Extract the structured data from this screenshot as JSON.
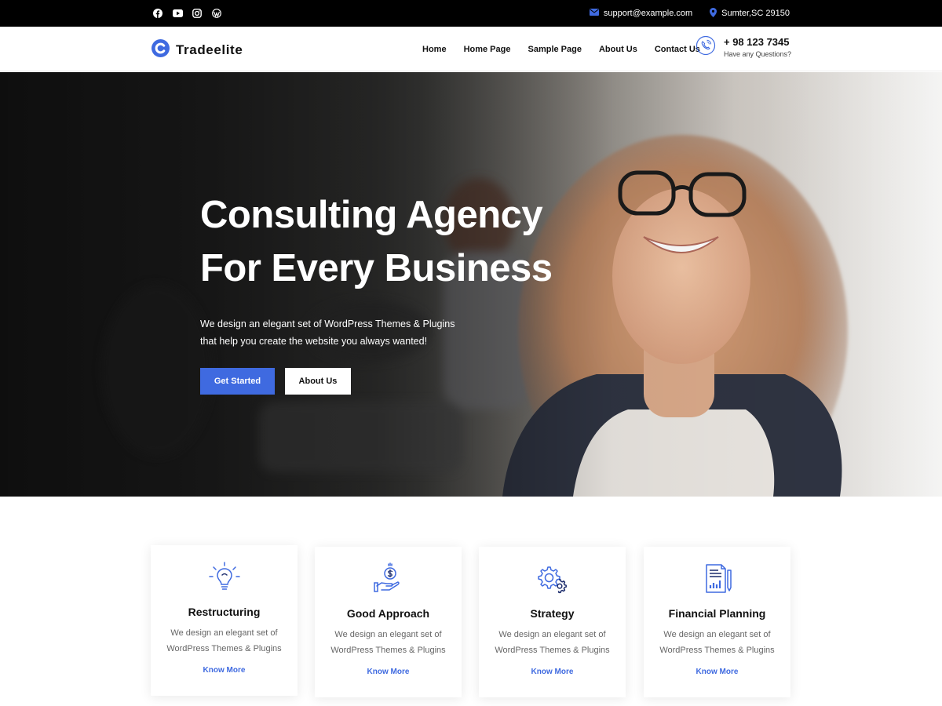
{
  "topbar": {
    "social": [
      {
        "name": "facebook-icon"
      },
      {
        "name": "youtube-icon"
      },
      {
        "name": "instagram-icon"
      },
      {
        "name": "wordpress-icon"
      }
    ],
    "email": "support@example.com",
    "address": "Sumter,SC 29150",
    "icons": {
      "email": "envelope-icon",
      "address": "map-pin-icon"
    }
  },
  "header": {
    "logo_text": "Tradeelite",
    "nav": [
      "Home",
      "Home Page",
      "Sample Page",
      "About Us",
      "Contact Us"
    ],
    "phone": "+ 98 123 7345",
    "phone_sub": "Have any Questions?"
  },
  "hero": {
    "title": "Consulting Agency\nFor Every Business",
    "description": "We design an elegant set of WordPress Themes & Plugins that help you create the website you always wanted!",
    "primary_button": "Get Started",
    "secondary_button": "About Us"
  },
  "services": [
    {
      "icon": "lightbulb-icon",
      "title": "Restructuring",
      "description": "We design an elegant set of WordPress Themes & Plugins",
      "link": "Know More"
    },
    {
      "icon": "money-hand-icon",
      "title": "Good Approach",
      "description": "We design an elegant set of WordPress Themes & Plugins",
      "link": "Know More"
    },
    {
      "icon": "gears-icon",
      "title": "Strategy",
      "description": "We design an elegant set of WordPress Themes & Plugins",
      "link": "Know More"
    },
    {
      "icon": "report-document-icon",
      "title": "Financial Planning",
      "description": "We design an elegant set of WordPress Themes & Plugins",
      "link": "Know More"
    }
  ],
  "colors": {
    "accent": "#3f6ae0",
    "topbar": "#000000",
    "text": "#111111",
    "muted": "#666666"
  }
}
